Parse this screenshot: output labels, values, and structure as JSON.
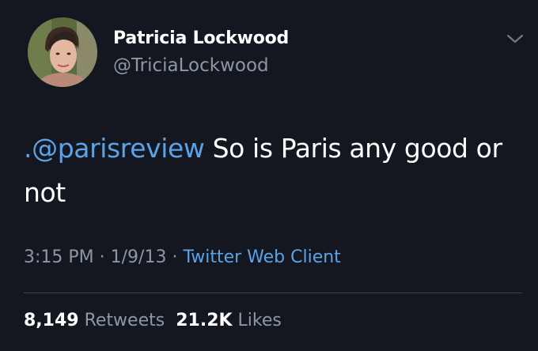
{
  "tweet": {
    "author_name": "Patricia Lockwood",
    "author_handle": "@TriciaLockwood",
    "text_prefix": ".",
    "mention": "@parisreview",
    "text_rest": " So is Paris any good or not",
    "time": "3:15 PM",
    "date": "1/9/13",
    "separator": " · ",
    "source": "Twitter Web Client",
    "retweets_count": "8,149",
    "retweets_label": "Retweets",
    "likes_count": "21.2K",
    "likes_label": "Likes"
  },
  "icons": {
    "menu": "chevron-down-icon",
    "avatar": "profile-photo"
  },
  "colors": {
    "background": "#14171f",
    "link": "#5aa3e8",
    "muted": "#8b98a5",
    "divider": "#38444d"
  }
}
